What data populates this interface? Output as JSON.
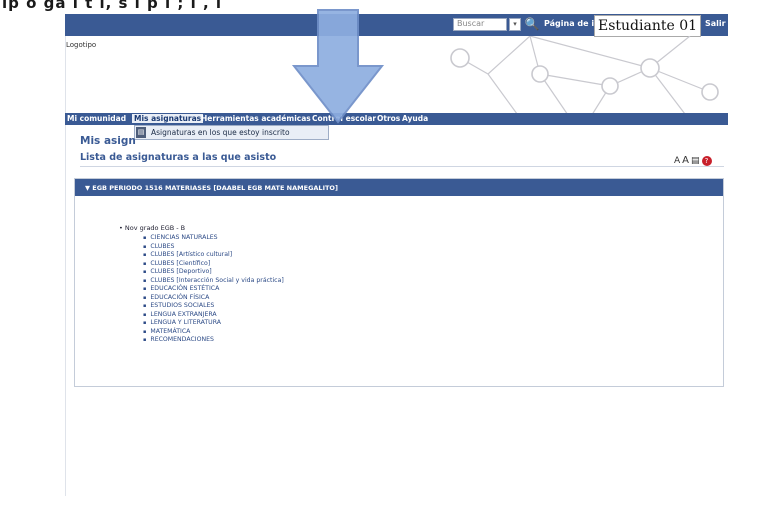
{
  "top_strip_text": "ip o ga ı t ı, s ı p ı ; ı , ı",
  "header": {
    "search_placeholder": "Buscar",
    "homepage_link": "Página de ini",
    "user_name": "Estudiante 01",
    "logout": "Salir",
    "logo_text": "Logotipo",
    "brand_color": "#3a5a94"
  },
  "nav": {
    "items": [
      "Mi comunidad",
      "Mis asignaturas",
      "Herramientas académicas",
      "Control escolar",
      "Otros",
      "Ayuda"
    ],
    "dropdown_item": "Asignaturas en los que estoy inscrito"
  },
  "main": {
    "title": "Mis asign",
    "subtitle": "Lista de asignaturas a las que asisto",
    "tools": [
      "A",
      "A",
      "print-icon",
      "help-icon"
    ]
  },
  "course": {
    "header": "▼ EGB PERIODO 1516 MATERIASES [DAABEL EGB MATE NAMEGALITO]",
    "grade": "• Nov grado EGB - B",
    "subjects": [
      "CIENCIAS NATURALES",
      "CLUBES",
      "CLUBES [Artístico cultural]",
      "CLUBES [Científico]",
      "CLUBES [Deportivo]",
      "CLUBES [Interacción Social y vida práctica]",
      "EDUCACIÓN ESTÉTICA",
      "EDUCACIÓN FÍSICA",
      "ESTUDIOS SOCIALES",
      "LENGUA EXTRANJERA",
      "LENGUA Y LITERATURA",
      "MATEMÁTICA",
      "RECOMENDACIONES"
    ]
  }
}
